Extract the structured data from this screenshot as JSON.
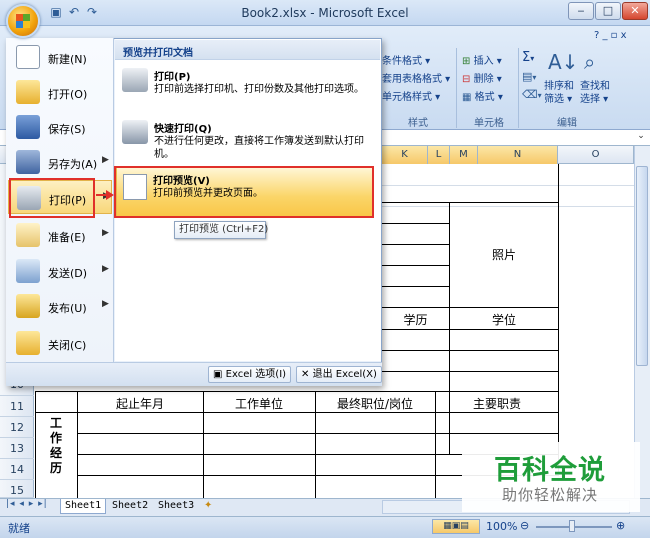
{
  "window": {
    "title": "Book2.xlsx - Microsoft Excel",
    "minimize_glyph": "‒",
    "maximize_glyph": "□",
    "close_glyph": "✕"
  },
  "qat": [
    "save-icon",
    "undo-icon",
    "redo-icon"
  ],
  "ribbon": {
    "styles": {
      "items": [
        "条件格式 ▾",
        "套用表格格式 ▾",
        "单元格样式 ▾"
      ],
      "label": "样式"
    },
    "cells": {
      "items": [
        "插入 ▾",
        "删除 ▾",
        "格式 ▾"
      ],
      "label": "单元格"
    },
    "editing": {
      "sort_filter": [
        "排序和",
        "筛选 ▾"
      ],
      "find_select": [
        "查找和",
        "选择 ▾"
      ],
      "label": "编辑"
    },
    "help_controls": "? _ ▫ x"
  },
  "columns": [
    "K",
    "L",
    "M",
    "N",
    "O"
  ],
  "rows": [
    "10",
    "11",
    "12",
    "13",
    "14",
    "15"
  ],
  "sheet": {
    "photo": "照片",
    "education": "学历",
    "degree": "学位",
    "work_header": [
      "起止年月",
      "工作单位",
      "最终职位/岗位",
      "主要职责"
    ],
    "work_label": "工\n作\n经\n历"
  },
  "office_menu": {
    "items": [
      {
        "label": "新建(N)",
        "icon": "new-document-icon",
        "arrow": false
      },
      {
        "label": "打开(O)",
        "icon": "open-folder-icon",
        "arrow": false
      },
      {
        "label": "保存(S)",
        "icon": "save-icon",
        "arrow": false
      },
      {
        "label": "另存为(A)",
        "icon": "save-as-icon",
        "arrow": true
      },
      {
        "label": "打印(P)",
        "icon": "printer-icon",
        "arrow": true
      },
      {
        "label": "准备(E)",
        "icon": "prepare-icon",
        "arrow": true
      },
      {
        "label": "发送(D)",
        "icon": "send-icon",
        "arrow": true
      },
      {
        "label": "发布(U)",
        "icon": "publish-icon",
        "arrow": true
      },
      {
        "label": "关闭(C)",
        "icon": "close-folder-icon",
        "arrow": false
      }
    ],
    "submenu_title": "预览并打印文档",
    "submenu": [
      {
        "title": "打印(P)",
        "desc": "打印前选择打印机、打印份数及其他打印选项。"
      },
      {
        "title": "快速打印(Q)",
        "desc": "不进行任何更改，直接将工作簿发送到默认打印机。"
      },
      {
        "title": "打印预览(V)",
        "desc": "打印前预览并更改页面。"
      }
    ],
    "tooltip": "打印预览 (Ctrl+F2)",
    "excel_options": "Excel 选项(I)",
    "exit_excel": "退出 Excel(X)"
  },
  "sheet_tabs": [
    "Sheet1",
    "Sheet2",
    "Sheet3"
  ],
  "status": {
    "ready": "就绪",
    "zoom": "100%"
  },
  "watermark": {
    "title": "百科全说",
    "subtitle": "助你轻松解决"
  }
}
